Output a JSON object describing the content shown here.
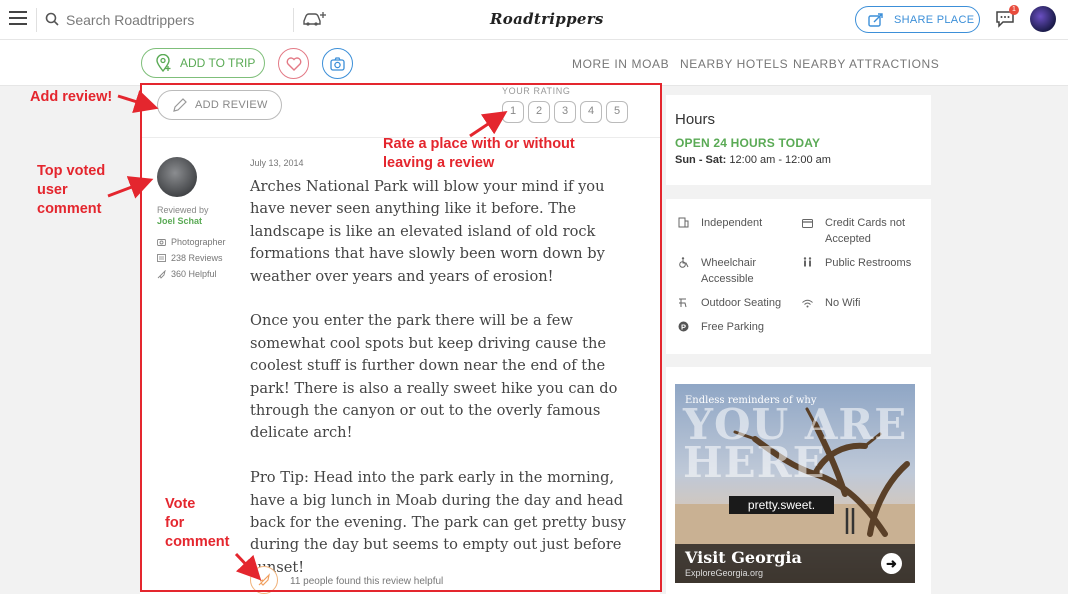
{
  "header": {
    "search_placeholder": "Search Roadtrippers",
    "logo_text": "Roadtrippers",
    "share_label": "SHARE PLACE",
    "notification_count": "1"
  },
  "actions": {
    "add_to_trip_label": "ADD TO TRIP",
    "nav_links": [
      "MORE IN MOAB",
      "NEARBY HOTELS",
      "NEARBY ATTRACTIONS"
    ]
  },
  "review_section": {
    "add_review_label": "ADD REVIEW",
    "your_rating_label": "YOUR RATING",
    "rating_options": [
      "1",
      "2",
      "3",
      "4",
      "5"
    ]
  },
  "review": {
    "reviewed_by_label": "Reviewed by",
    "reviewer_name": "Joel Schat",
    "reviewer_role": "Photographer",
    "reviewer_reviews": "238 Reviews",
    "reviewer_helpful": "360 Helpful",
    "date": "July 13, 2014",
    "paragraphs": [
      "Arches National Park will blow your mind if you have never seen anything like it before. The landscape is like an elevated island of old rock formations that have slowly been worn down by weather over years and years of erosion!",
      "Once you enter the park there will be a few somewhat cool spots but keep driving cause the coolest stuff is further down near the end of the park! There is also a really sweet hike you can do through the canyon or out to the overly famous delicate arch!",
      "Pro Tip: Head into the park early in the morning, have a big lunch in Moab during the day and head back for the evening. The park can get pretty busy during the day but seems to empty out just before sunset!"
    ],
    "helpful_text": "11 people found this review helpful"
  },
  "hours": {
    "title": "Hours",
    "status": "OPEN 24 HOURS TODAY",
    "days": "Sun - Sat:",
    "times": "12:00 am - 12:00 am"
  },
  "amenities": {
    "independent": "Independent",
    "credit_cards": "Credit Cards not Accepted",
    "wheelchair": "Wheelchair Accessible",
    "restrooms": "Public Restrooms",
    "outdoor_seating": "Outdoor Seating",
    "wifi": "No Wifi",
    "parking": "Free Parking"
  },
  "ad": {
    "tagline": "Endless reminders of why",
    "headline_1": "YOU ARE",
    "headline_2": "HERE",
    "pretty_sweet": "pretty.sweet.",
    "visit": "Visit Georgia",
    "site": "ExploreGeorgia.org"
  },
  "annotations": {
    "add_review": "Add review!",
    "rate_place_1": "Rate a place with or without",
    "rate_place_2": "leaving  a review",
    "top_voted_1": "Top voted",
    "top_voted_2": "user",
    "top_voted_3": "comment",
    "vote_1": "Vote",
    "vote_2": "for",
    "vote_3": "comment"
  },
  "colors": {
    "green": "#5aaa55",
    "blue": "#3c8fd8",
    "annotation_red": "#e4262e"
  }
}
